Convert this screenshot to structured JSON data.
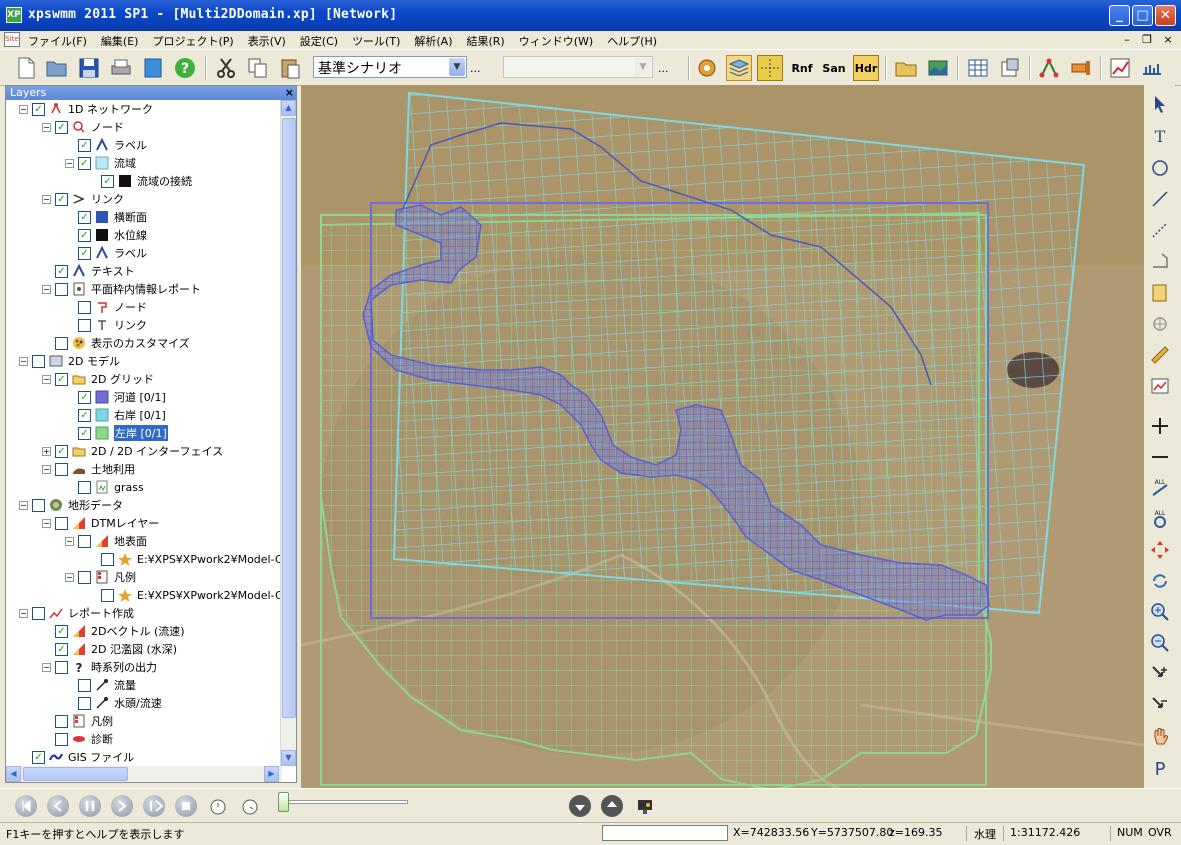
{
  "window": {
    "title": "xpswmm 2011 SP1 - [Multi2DDomain.xp] [Network]",
    "app_icon": "XP",
    "doc_icon": "Site",
    "minimize": "_",
    "maximize": "□",
    "close": "✕",
    "mdi_minimize": "–",
    "mdi_restore": "❐",
    "mdi_close": "×"
  },
  "menu": [
    "ファイル(F)",
    "編集(E)",
    "プロジェクト(P)",
    "表示(V)",
    "設定(C)",
    "ツール(T)",
    "解析(A)",
    "結果(R)",
    "ウィンドウ(W)",
    "ヘルプ(H)"
  ],
  "toolbar": {
    "scenario_value": "基準シナリオ",
    "scenario_more": "...",
    "combo2_value": "",
    "combo2_more": "...",
    "rnf_label": "Rnf",
    "san_label": "San",
    "hdr_label": "Hdr"
  },
  "layers_panel": {
    "title": "Layers",
    "close": "×",
    "rows": [
      {
        "label": "1D ネットワーク",
        "checked": true
      },
      {
        "label": "ノード",
        "checked": true
      },
      {
        "label": "ラベル",
        "checked": true
      },
      {
        "label": "流域",
        "checked": true
      },
      {
        "label": "流域の接続",
        "checked": true
      },
      {
        "label": "リンク",
        "checked": true
      },
      {
        "label": "横断面",
        "checked": true
      },
      {
        "label": "水位線",
        "checked": true
      },
      {
        "label": "ラベル",
        "checked": true
      },
      {
        "label": "テキスト",
        "checked": true
      },
      {
        "label": "平面枠内情報レポート",
        "checked": false
      },
      {
        "label": "ノード",
        "checked": false
      },
      {
        "label": "リンク",
        "checked": false
      },
      {
        "label": "表示のカスタマイズ",
        "checked": false
      },
      {
        "label": "2D モデル",
        "checked": false
      },
      {
        "label": "2D グリッド",
        "checked": true
      },
      {
        "label": "河道 [0/1]",
        "checked": true
      },
      {
        "label": "右岸 [0/1]",
        "checked": true
      },
      {
        "label": "左岸 [0/1]",
        "checked": true
      },
      {
        "label": "2D / 2D インターフェイス",
        "checked": true
      },
      {
        "label": "土地利用",
        "checked": false
      },
      {
        "label": "grass",
        "checked": false
      },
      {
        "label": "地形データ",
        "checked": false
      },
      {
        "label": "DTMレイヤー",
        "checked": false
      },
      {
        "label": "地表面",
        "checked": false
      },
      {
        "label": "E:¥XPS¥XPwork2¥Model-G",
        "checked": false
      },
      {
        "label": "凡例",
        "checked": false
      },
      {
        "label": "E:¥XPS¥XPwork2¥Model-G",
        "checked": false
      },
      {
        "label": "レポート作成",
        "checked": false
      },
      {
        "label": "2Dベクトル (流速)",
        "checked": true
      },
      {
        "label": "2D 氾濫図 (水深)",
        "checked": true
      },
      {
        "label": "時系列の出力",
        "checked": false
      },
      {
        "label": "流量",
        "checked": false
      },
      {
        "label": "水頭/流速",
        "checked": false
      },
      {
        "label": "凡例",
        "checked": false
      },
      {
        "label": "診断",
        "checked": false
      },
      {
        "label": "GIS ファイル",
        "checked": true
      }
    ]
  },
  "colors": {
    "grid_cyan": "#7fd9e3",
    "grid_green": "#8fd68a",
    "grid_channel": "#6c6fd8",
    "selection": "#316ac5"
  },
  "status": {
    "help_text": "F1キーを押すとヘルプを表示します",
    "x": "X=742833.56",
    "y": "Y=5737507.80",
    "z": "z=169.35",
    "mode": "水理",
    "scale": "1:31172.426",
    "num": "NUM",
    "ovr": "OVR"
  }
}
